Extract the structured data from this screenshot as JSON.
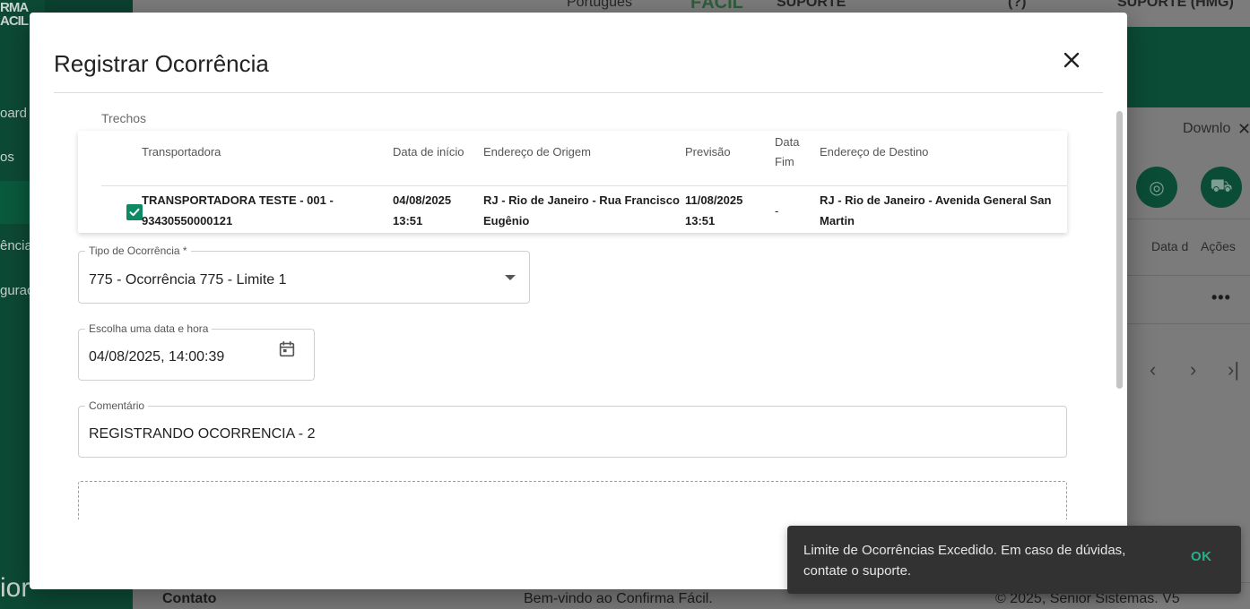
{
  "background": {
    "logo_line1": "RMA",
    "logo_line2": "ACIL",
    "sidebar_items": [
      "oard",
      "os",
      "ência",
      "guraç"
    ],
    "sidebar_bottom": "ior",
    "topbar": {
      "language": "Português",
      "brand": "FÁCIL",
      "support": "SUPORTE",
      "help": "(?)",
      "user": "SUPORTE (HMG)"
    },
    "download_label": "Downlo",
    "columns": [
      "Data d",
      "Ações"
    ],
    "row_menu": "•••",
    "footer": {
      "contact": "Contato",
      "welcome": "Bem-vindo ao Confirma Fácil.",
      "copyright": "© 2025, Senior Sistemas. V5"
    }
  },
  "modal": {
    "title": "Registrar Ocorrência",
    "trechos": {
      "label": "Trechos",
      "headers": {
        "transportadora": "Transportadora",
        "data_inicio": "Data de início",
        "endereco_origem": "Endereço de Origem",
        "previsao": "Previsão",
        "data_fim_1": "Data",
        "data_fim_2": "Fim",
        "endereco_destino": "Endereço de Destino"
      },
      "row": {
        "checked": true,
        "transportadora_1": "TRANSPORTADORA TESTE - 001 -",
        "transportadora_2": "93430550000121",
        "data_inicio_1": "04/08/2025",
        "data_inicio_2": "13:51",
        "origem_1": "RJ - Rio de Janeiro - Rua Francisco",
        "origem_2": "Eugênio",
        "previsao_1": "11/08/2025",
        "previsao_2": "13:51",
        "data_fim": "-",
        "destino_1": "RJ - Rio de Janeiro - Avenida General San",
        "destino_2": "Martin"
      }
    },
    "tipo_ocorrencia": {
      "label": "Tipo de Ocorrência *",
      "value": "775 - Ocorrência 775 - Limite 1"
    },
    "data_hora": {
      "label": "Escolha uma data e hora",
      "value": "04/08/2025, 14:00:39"
    },
    "comentario": {
      "label": "Comentário",
      "value": "REGISTRANDO OCORRENCIA - 2"
    }
  },
  "snackbar": {
    "message": "Limite de Ocorrências Excedido. Em caso de dúvidas, contate o suporte.",
    "action": "OK"
  },
  "colors": {
    "brand_green": "#0b4c37",
    "accent_green": "#0d8a64",
    "snackbar_bg": "#323232",
    "snackbar_action": "#26b08a"
  }
}
